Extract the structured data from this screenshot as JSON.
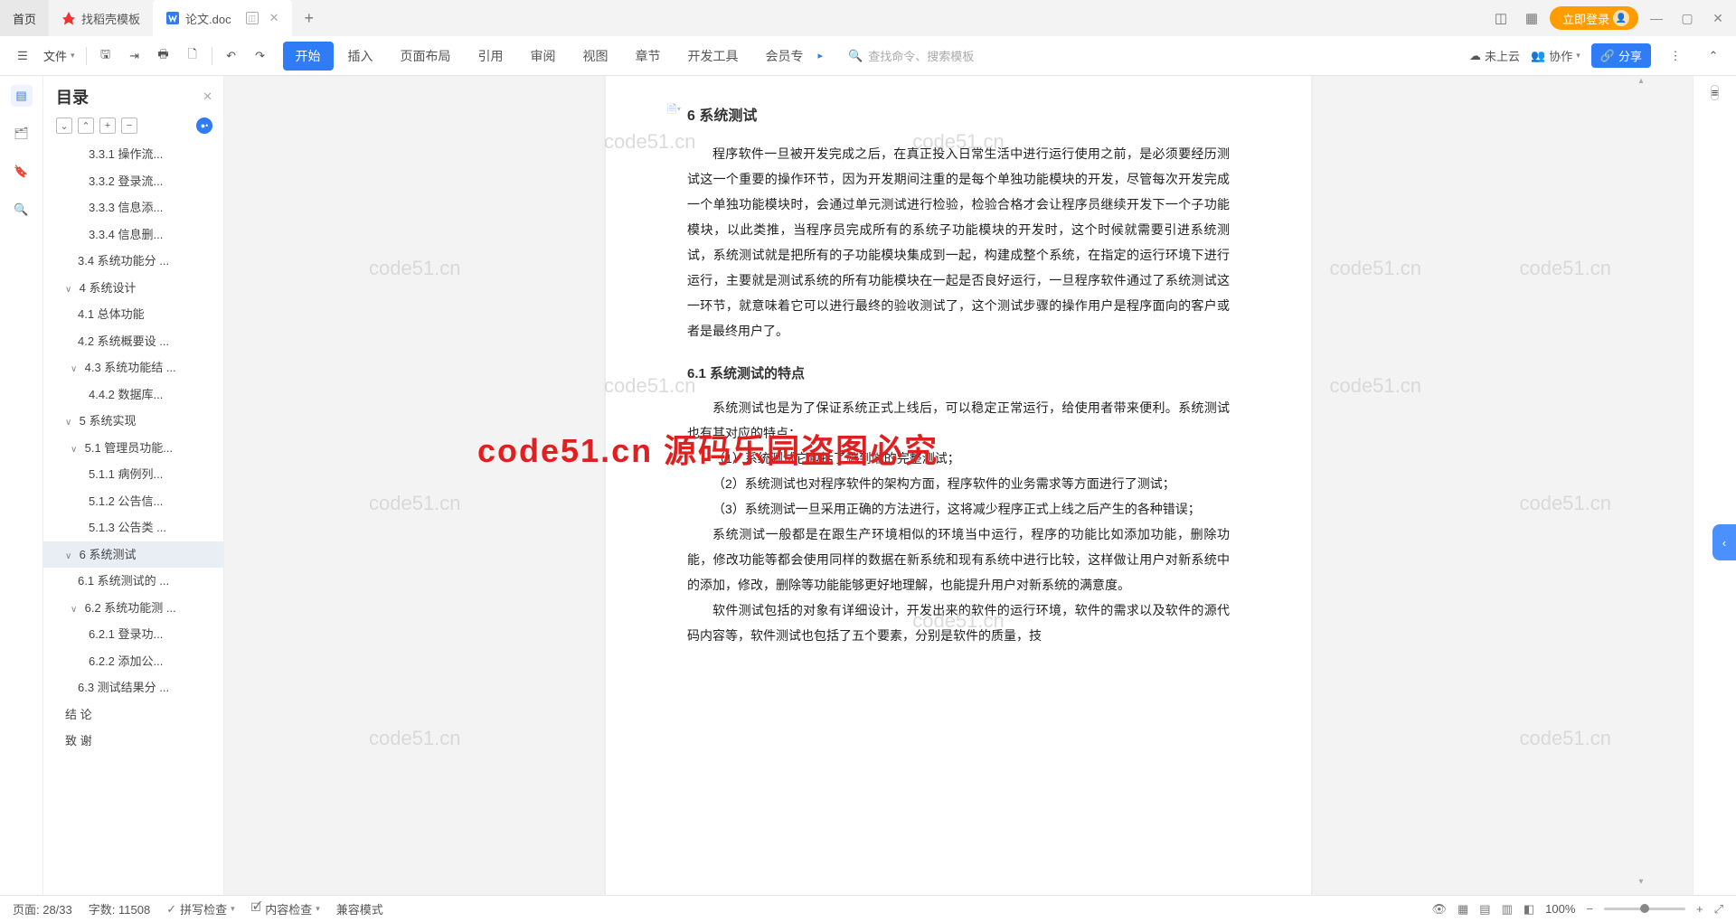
{
  "tabs": {
    "home": "首页",
    "template": "找稻壳模板",
    "doc": "论文.doc",
    "add": "+"
  },
  "title_right": {
    "login": "立即登录"
  },
  "ribbon": {
    "file": "文件",
    "menus": [
      "开始",
      "插入",
      "页面布局",
      "引用",
      "审阅",
      "视图",
      "章节",
      "开发工具",
      "会员专"
    ],
    "search_placeholder": "查找命令、搜索模板",
    "cloud": "未上云",
    "collab": "协作",
    "share": "分享"
  },
  "outline": {
    "title": "目录",
    "items": [
      {
        "pad": 36,
        "chev": "",
        "label": "3.3.1  操作流..."
      },
      {
        "pad": 36,
        "chev": "",
        "label": "3.3.2  登录流..."
      },
      {
        "pad": 36,
        "chev": "",
        "label": "3.3.3  信息添..."
      },
      {
        "pad": 36,
        "chev": "",
        "label": "3.3.4  信息删..."
      },
      {
        "pad": 24,
        "chev": "",
        "label": "3.4  系统功能分 ..."
      },
      {
        "pad": 10,
        "chev": "∨",
        "label": "4  系统设计"
      },
      {
        "pad": 24,
        "chev": "",
        "label": "4.1  总体功能"
      },
      {
        "pad": 24,
        "chev": "",
        "label": "4.2  系统概要设 ..."
      },
      {
        "pad": 16,
        "chev": "∨",
        "label": "4.3  系统功能结 ..."
      },
      {
        "pad": 36,
        "chev": "",
        "label": "4.4.2  数据库..."
      },
      {
        "pad": 10,
        "chev": "∨",
        "label": "5  系统实现"
      },
      {
        "pad": 16,
        "chev": "∨",
        "label": "5.1  管理员功能..."
      },
      {
        "pad": 36,
        "chev": "",
        "label": "5.1.1  病例列..."
      },
      {
        "pad": 36,
        "chev": "",
        "label": "5.1.2  公告信..."
      },
      {
        "pad": 36,
        "chev": "",
        "label": "5.1.3 公告类 ..."
      },
      {
        "pad": 10,
        "chev": "∨",
        "label": "6  系统测试",
        "sel": true
      },
      {
        "pad": 24,
        "chev": "",
        "label": "6.1  系统测试的 ..."
      },
      {
        "pad": 16,
        "chev": "∨",
        "label": "6.2  系统功能测 ..."
      },
      {
        "pad": 36,
        "chev": "",
        "label": "6.2.1  登录功..."
      },
      {
        "pad": 36,
        "chev": "",
        "label": "6.2.2  添加公..."
      },
      {
        "pad": 24,
        "chev": "",
        "label": "6.3 测试结果分 ..."
      },
      {
        "pad": 10,
        "chev": "",
        "label": "结    论"
      },
      {
        "pad": 10,
        "chev": "",
        "label": "致    谢"
      }
    ]
  },
  "document": {
    "h1": "6  系统测试",
    "p1": "程序软件一旦被开发完成之后，在真正投入日常生活中进行运行使用之前，是必须要经历测试这一个重要的操作环节，因为开发期间注重的是每个单独功能模块的开发，尽管每次开发完成一个单独功能模块时，会通过单元测试进行检验，检验合格才会让程序员继续开发下一个子功能模块，以此类推，当程序员完成所有的系统子功能模块的开发时，这个时候就需要引进系统测试，系统测试就是把所有的子功能模块集成到一起，构建成整个系统，在指定的运行环境下进行运行，主要就是测试系统的所有功能模块在一起是否良好运行，一旦程序软件通过了系统测试这一环节，就意味着它可以进行最终的验收测试了，这个测试步骤的操作用户是程序面向的客户或者是最终用户了。",
    "h2": "6.1  系统测试的特点",
    "p2": "系统测试也是为了保证系统正式上线后，可以稳定正常运行，给使用者带来便利。系统测试也有其对应的特点：",
    "p3": "（1）系统测试它包括了端到端的完整测试；",
    "p4": "（2）系统测试也对程序软件的架构方面，程序软件的业务需求等方面进行了测试；",
    "p5": "（3）系统测试一旦采用正确的方法进行，这将减少程序正式上线之后产生的各种错误；",
    "p6": "系统测试一般都是在跟生产环境相似的环境当中运行，程序的功能比如添加功能，删除功能，修改功能等都会使用同样的数据在新系统和现有系统中进行比较，这样做让用户对新系统中的添加，修改，删除等功能能够更好地理解，也能提升用户对新系统的满意度。",
    "p7": "软件测试包括的对象有详细设计，开发出来的软件的运行环境，软件的需求以及软件的源代码内容等，软件测试也包括了五个要素，分别是软件的质量，技"
  },
  "watermarks": {
    "small": "code51.cn",
    "big": "code51.cn  源码乐园盗图必究"
  },
  "status": {
    "page": "页面: 28/33",
    "words": "字数: 11508",
    "spell": "拼写检查",
    "content": "内容检查",
    "compat": "兼容模式",
    "zoom": "100%"
  }
}
